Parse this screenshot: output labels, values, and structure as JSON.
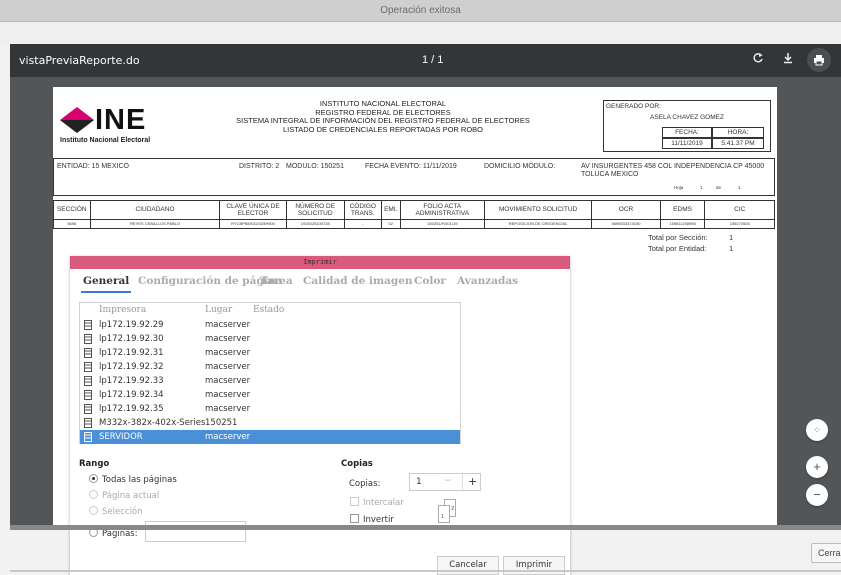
{
  "status_bar": {
    "message": "Operación exitosa"
  },
  "viewer": {
    "file_name": "vistaPreviaReporte.do",
    "page_indicator": "1 / 1",
    "icons": [
      "rotate-icon",
      "download-icon",
      "print-icon"
    ]
  },
  "report": {
    "logo_text": "INE",
    "logo_subtitle": "Instituto Nacional Electoral",
    "title_lines": [
      "INSTITUTO NACIONAL ELECTORAL",
      "REGISTRO FEDERAL DE ELECTORES",
      "SISTEMA INTEGRAL DE INFORMACIÓN DEL REGISTRO FEDERAL DE ELECTORES",
      "LISTADO DE CREDENCIALES REPORTADAS POR ROBO"
    ],
    "generated_by_label": "GENERADO POR:",
    "generated_by": "ASELA CHAVEZ GOMEZ",
    "date_label": "FECHA:",
    "time_label": "HORA:",
    "date": "11/11/2019",
    "time": "5.41.37 PM",
    "entidad": "ENTIDAD: 15 MEXICO",
    "distrito": "DISTRITO: 2",
    "modulo": "MODULO: 150251",
    "fecha_evento": "FECHA EVENTO: 11/11/2019",
    "domicilio_label": "DOMICILIO MÓDULO:",
    "domicilio": "AV INSURGENTES 458 COL INDEPENDENCIA CP 45000 TOLUCA MEXICO",
    "hoja": "Hoja",
    "hoja_num": "1",
    "de": "de",
    "hoja_total": "1",
    "columns": [
      "SECCIÓN",
      "CIUDADANO",
      "CLAVE ÚNICA DE ELECTOR",
      "NÚMERO DE SOLICITUD",
      "CÓDIGO TRANS.",
      "EMI.",
      "FOLIO ACTA ADMINISTRATIVA",
      "MOVIMIENTO SOLICITUD",
      "OCR",
      "EDMS",
      "CIC"
    ],
    "rows": [
      [
        "5698",
        "REYES CEBALLOS PABLO",
        "RYCBPB69102325H900",
        "1915025100728",
        "-",
        "02",
        "150251/F/001/19",
        "REPOSICION DE CREDENCIAL",
        "5698033374150",
        "159811258998",
        "159273505"
      ]
    ],
    "total_seccion_label": "Total por Sección:",
    "total_seccion": "1",
    "total_entidad_label": "Total por Entidad:",
    "total_entidad": "1"
  },
  "print_dialog": {
    "title": "Imprimir",
    "tabs": [
      "General",
      "Configuración de página",
      "Tarea",
      "Calidad de imagen",
      "Color",
      "Avanzadas"
    ],
    "active_tab": "General",
    "printer_headers": [
      "Impresora",
      "Lugar",
      "Estado"
    ],
    "printers": [
      {
        "name": "lp172.19.92.29",
        "location": "macserver"
      },
      {
        "name": "lp172.19.92.30",
        "location": "macserver"
      },
      {
        "name": "lp172.19.92.31",
        "location": "macserver"
      },
      {
        "name": "lp172.19.92.32",
        "location": "macserver"
      },
      {
        "name": "lp172.19.92.33",
        "location": "macserver"
      },
      {
        "name": "lp172.19.92.34",
        "location": "macserver"
      },
      {
        "name": "lp172.19.92.35",
        "location": "macserver"
      },
      {
        "name": "M332x-382x-402x-Series",
        "location": "150251"
      },
      {
        "name": "SERVIDOR",
        "location": "macserver"
      }
    ],
    "selected_printer": "SERVIDOR",
    "range_title": "Rango",
    "range_options": [
      "Todas las páginas",
      "Página actual",
      "Selección",
      "Páginas:"
    ],
    "range_selected": "Todas las páginas",
    "copies_title": "Copias",
    "copies_label": "Copias:",
    "copies_value": "1",
    "collate_label": "Intercalar",
    "reverse_label": "Invertir",
    "collate_preview": [
      "1",
      "2"
    ],
    "cancel_label": "Cancelar",
    "print_label": "Imprimir"
  },
  "side_controls": {
    "close_label": "Cerra"
  },
  "colors": {
    "accent": "#3a7bd5",
    "dialog_title_bg": "#d95a7b",
    "selected_row": "#4a90d9",
    "viewer_toolbar": "#323639"
  }
}
